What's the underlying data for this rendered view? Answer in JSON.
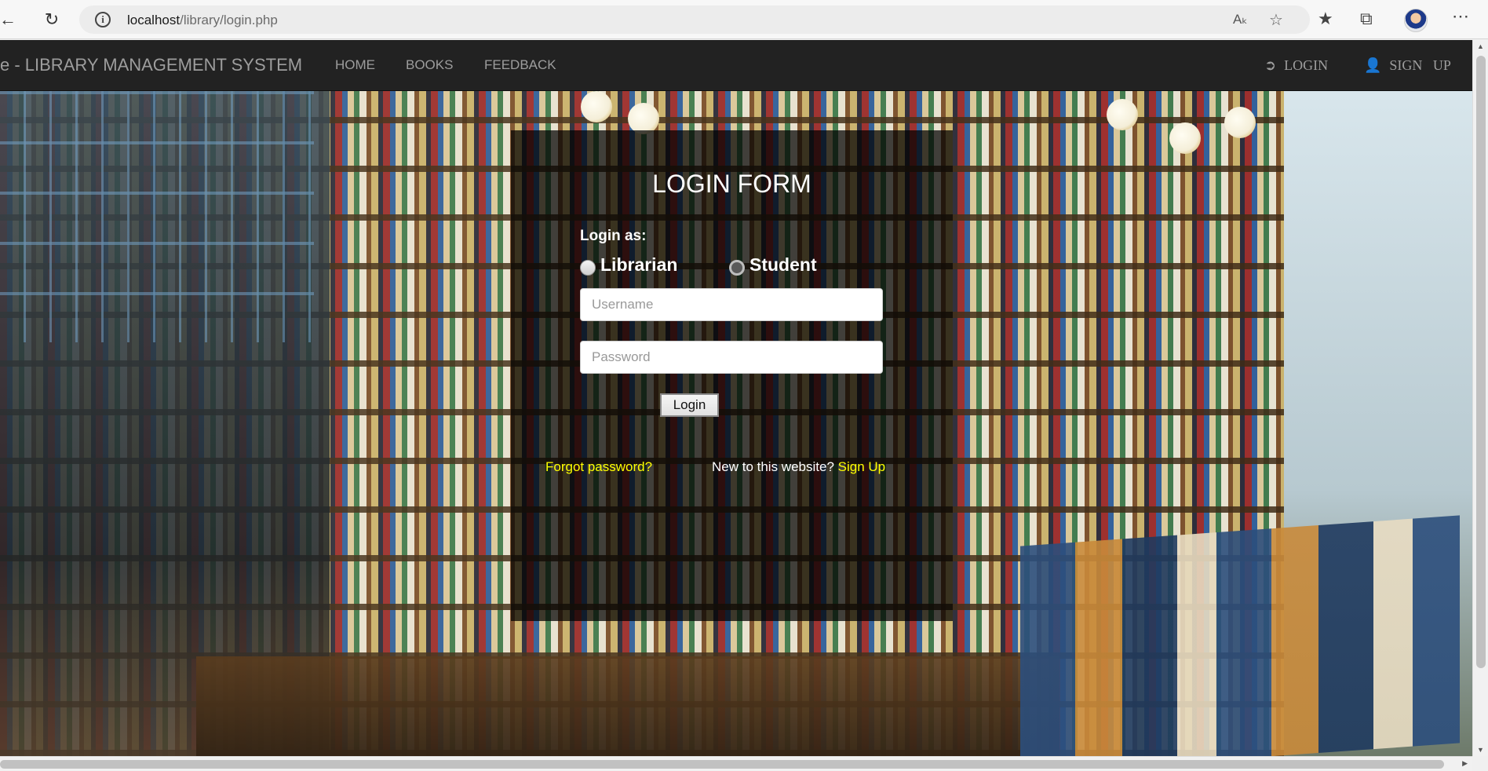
{
  "browser": {
    "url_host": "localhost",
    "url_path": "/library/login.php",
    "icons": [
      "back-icon",
      "refresh-icon",
      "info-icon",
      "read-aloud-icon",
      "add-favorite-icon",
      "favorites-icon",
      "collections-icon",
      "profile-avatar",
      "more-icon"
    ]
  },
  "navbar": {
    "brand": "e - LIBRARY MANAGEMENT SYSTEM",
    "links": [
      "HOME",
      "BOOKS",
      "FEEDBACK"
    ],
    "login": "LOGIN",
    "signup": "SIGN   UP"
  },
  "login_form": {
    "title": "LOGIN FORM",
    "login_as_label": "Login as:",
    "roles": [
      "Librarian",
      "Student"
    ],
    "selected_role": "Student",
    "username_placeholder": "Username",
    "password_placeholder": "Password",
    "login_button": "Login",
    "forgot_password": "Forgot password?",
    "new_user_text": "New to this website?",
    "sign_up_link": "Sign Up"
  },
  "colors": {
    "navbar_bg": "#222222",
    "nav_text": "#9d9d9d",
    "link_yellow": "#ffff00",
    "form_overlay": "rgba(0,0,0,0.72)"
  }
}
